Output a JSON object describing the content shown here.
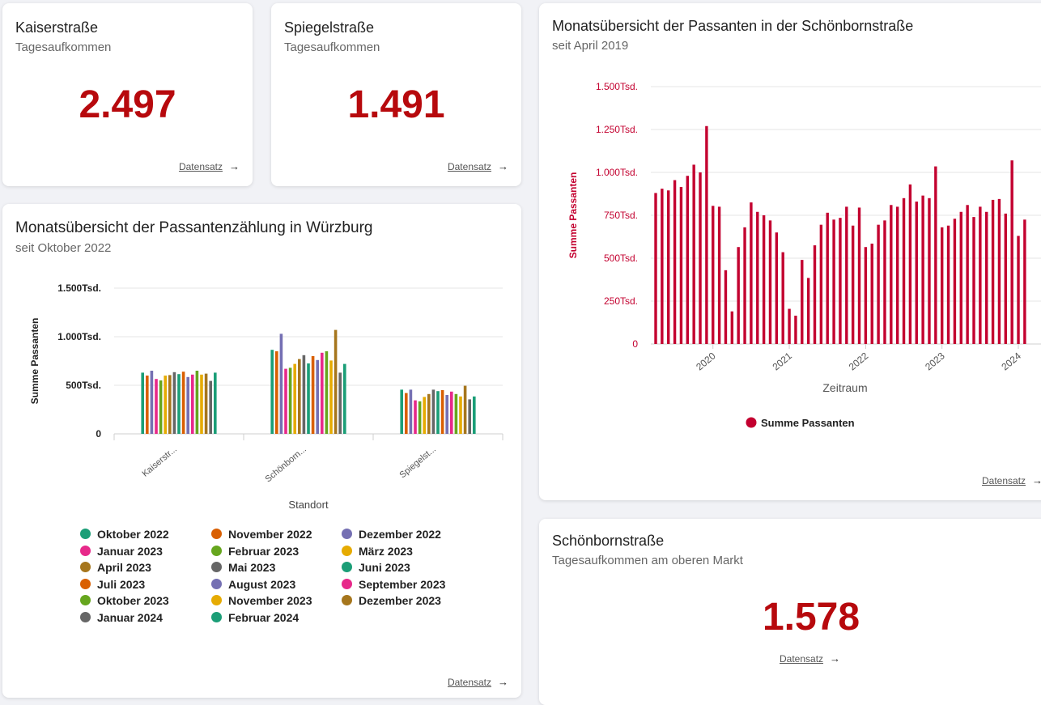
{
  "kpis": {
    "kaiser": {
      "title": "Kaiserstraße",
      "subtitle": "Tagesaufkommen",
      "value": "2.497",
      "link": "Datensatz"
    },
    "spiegel": {
      "title": "Spiegelstraße",
      "subtitle": "Tagesaufkommen",
      "value": "1.491",
      "link": "Datensatz"
    },
    "schoenborn": {
      "title": "Schönbornstraße",
      "subtitle": "Tagesaufkommen am oberen Markt",
      "value": "1.578",
      "link": "Datensatz"
    }
  },
  "arrow": "→",
  "colors": {
    "accent": "#b7090d",
    "bar": "#c3002f"
  },
  "chart_data": [
    {
      "type": "bar",
      "title": "Monatsübersicht der Passantenzählung in Würzburg",
      "subtitle": "seit Oktober 2022",
      "xlabel": "Standort",
      "ylabel": "Summe Passanten",
      "ylim": [
        0,
        1500000
      ],
      "yticks": [
        {
          "value": 0,
          "label": "0"
        },
        {
          "value": 500000,
          "label": "500Tsd."
        },
        {
          "value": 1000000,
          "label": "1.000Tsd."
        },
        {
          "value": 1500000,
          "label": "1.500Tsd."
        }
      ],
      "categories": [
        "Kaiserstr...",
        "Schönborn...",
        "Spiegelst..."
      ],
      "legend_position": "bottom",
      "link": "Datensatz",
      "series": [
        {
          "name": "Oktober 2022",
          "color": "#1b9e77",
          "values": [
            630000,
            865000,
            455000
          ]
        },
        {
          "name": "November 2022",
          "color": "#d95f02",
          "values": [
            600000,
            850000,
            420000
          ]
        },
        {
          "name": "Dezember 2022",
          "color": "#7570b3",
          "values": [
            650000,
            1030000,
            455000
          ]
        },
        {
          "name": "Januar 2023",
          "color": "#e7298a",
          "values": [
            565000,
            670000,
            345000
          ]
        },
        {
          "name": "Februar 2023",
          "color": "#66a61e",
          "values": [
            550000,
            680000,
            335000
          ]
        },
        {
          "name": "März 2023",
          "color": "#e6ab02",
          "values": [
            600000,
            720000,
            380000
          ]
        },
        {
          "name": "April 2023",
          "color": "#a6761d",
          "values": [
            605000,
            770000,
            410000
          ]
        },
        {
          "name": "Mai 2023",
          "color": "#666666",
          "values": [
            635000,
            810000,
            455000
          ]
        },
        {
          "name": "Juni 2023",
          "color": "#1b9e77",
          "values": [
            615000,
            725000,
            440000
          ]
        },
        {
          "name": "Juli 2023",
          "color": "#d95f02",
          "values": [
            640000,
            800000,
            450000
          ]
        },
        {
          "name": "August 2023",
          "color": "#7570b3",
          "values": [
            585000,
            760000,
            400000
          ]
        },
        {
          "name": "September 2023",
          "color": "#e7298a",
          "values": [
            610000,
            835000,
            435000
          ]
        },
        {
          "name": "Oktober 2023",
          "color": "#66a61e",
          "values": [
            650000,
            850000,
            410000
          ]
        },
        {
          "name": "November 2023",
          "color": "#e6ab02",
          "values": [
            610000,
            755000,
            385000
          ]
        },
        {
          "name": "Dezember 2023",
          "color": "#a6761d",
          "values": [
            620000,
            1070000,
            495000
          ]
        },
        {
          "name": "Januar 2024",
          "color": "#666666",
          "values": [
            545000,
            630000,
            355000
          ]
        },
        {
          "name": "Februar 2024",
          "color": "#1b9e77",
          "values": [
            630000,
            720000,
            385000
          ]
        }
      ]
    },
    {
      "type": "bar",
      "title": "Monatsübersicht der Passanten in der Schönbornstraße",
      "subtitle": "seit April 2019",
      "xlabel": "Zeitraum",
      "ylabel": "Summe Passanten",
      "ylim": [
        0,
        1500000
      ],
      "yticks": [
        {
          "value": 0,
          "label": "0"
        },
        {
          "value": 250000,
          "label": "250Tsd."
        },
        {
          "value": 500000,
          "label": "500Tsd."
        },
        {
          "value": 750000,
          "label": "750Tsd."
        },
        {
          "value": 1000000,
          "label": "1.000Tsd."
        },
        {
          "value": 1250000,
          "label": "1.250Tsd."
        },
        {
          "value": 1500000,
          "label": "1.500Tsd."
        }
      ],
      "xticks": [
        "2020",
        "2021",
        "2022",
        "2023",
        "2024"
      ],
      "legend_position": "bottom",
      "link": "Datensatz",
      "series": [
        {
          "name": "Summe Passanten",
          "color": "#c3002f",
          "x": [
            "2019-04",
            "2019-05",
            "2019-06",
            "2019-07",
            "2019-08",
            "2019-09",
            "2019-10",
            "2019-11",
            "2019-12",
            "2020-01",
            "2020-02",
            "2020-03",
            "2020-04",
            "2020-05",
            "2020-06",
            "2020-07",
            "2020-08",
            "2020-09",
            "2020-10",
            "2020-11",
            "2020-12",
            "2021-01",
            "2021-02",
            "2021-03",
            "2021-04",
            "2021-05",
            "2021-06",
            "2021-07",
            "2021-08",
            "2021-09",
            "2021-10",
            "2021-11",
            "2021-12",
            "2022-01",
            "2022-02",
            "2022-03",
            "2022-04",
            "2022-05",
            "2022-06",
            "2022-07",
            "2022-08",
            "2022-09",
            "2022-10",
            "2022-11",
            "2022-12",
            "2023-01",
            "2023-02",
            "2023-03",
            "2023-04",
            "2023-05",
            "2023-06",
            "2023-07",
            "2023-08",
            "2023-09",
            "2023-10",
            "2023-11",
            "2023-12",
            "2024-01",
            "2024-02"
          ],
          "values": [
            880000,
            905000,
            895000,
            955000,
            915000,
            980000,
            1045000,
            1000000,
            1270000,
            805000,
            800000,
            430000,
            190000,
            565000,
            680000,
            825000,
            770000,
            750000,
            720000,
            650000,
            535000,
            205000,
            165000,
            490000,
            385000,
            575000,
            695000,
            765000,
            725000,
            735000,
            800000,
            690000,
            795000,
            565000,
            585000,
            695000,
            720000,
            810000,
            800000,
            850000,
            930000,
            830000,
            865000,
            850000,
            1035000,
            680000,
            690000,
            730000,
            770000,
            810000,
            740000,
            800000,
            770000,
            840000,
            845000,
            760000,
            1070000,
            630000,
            725000
          ]
        }
      ]
    }
  ]
}
